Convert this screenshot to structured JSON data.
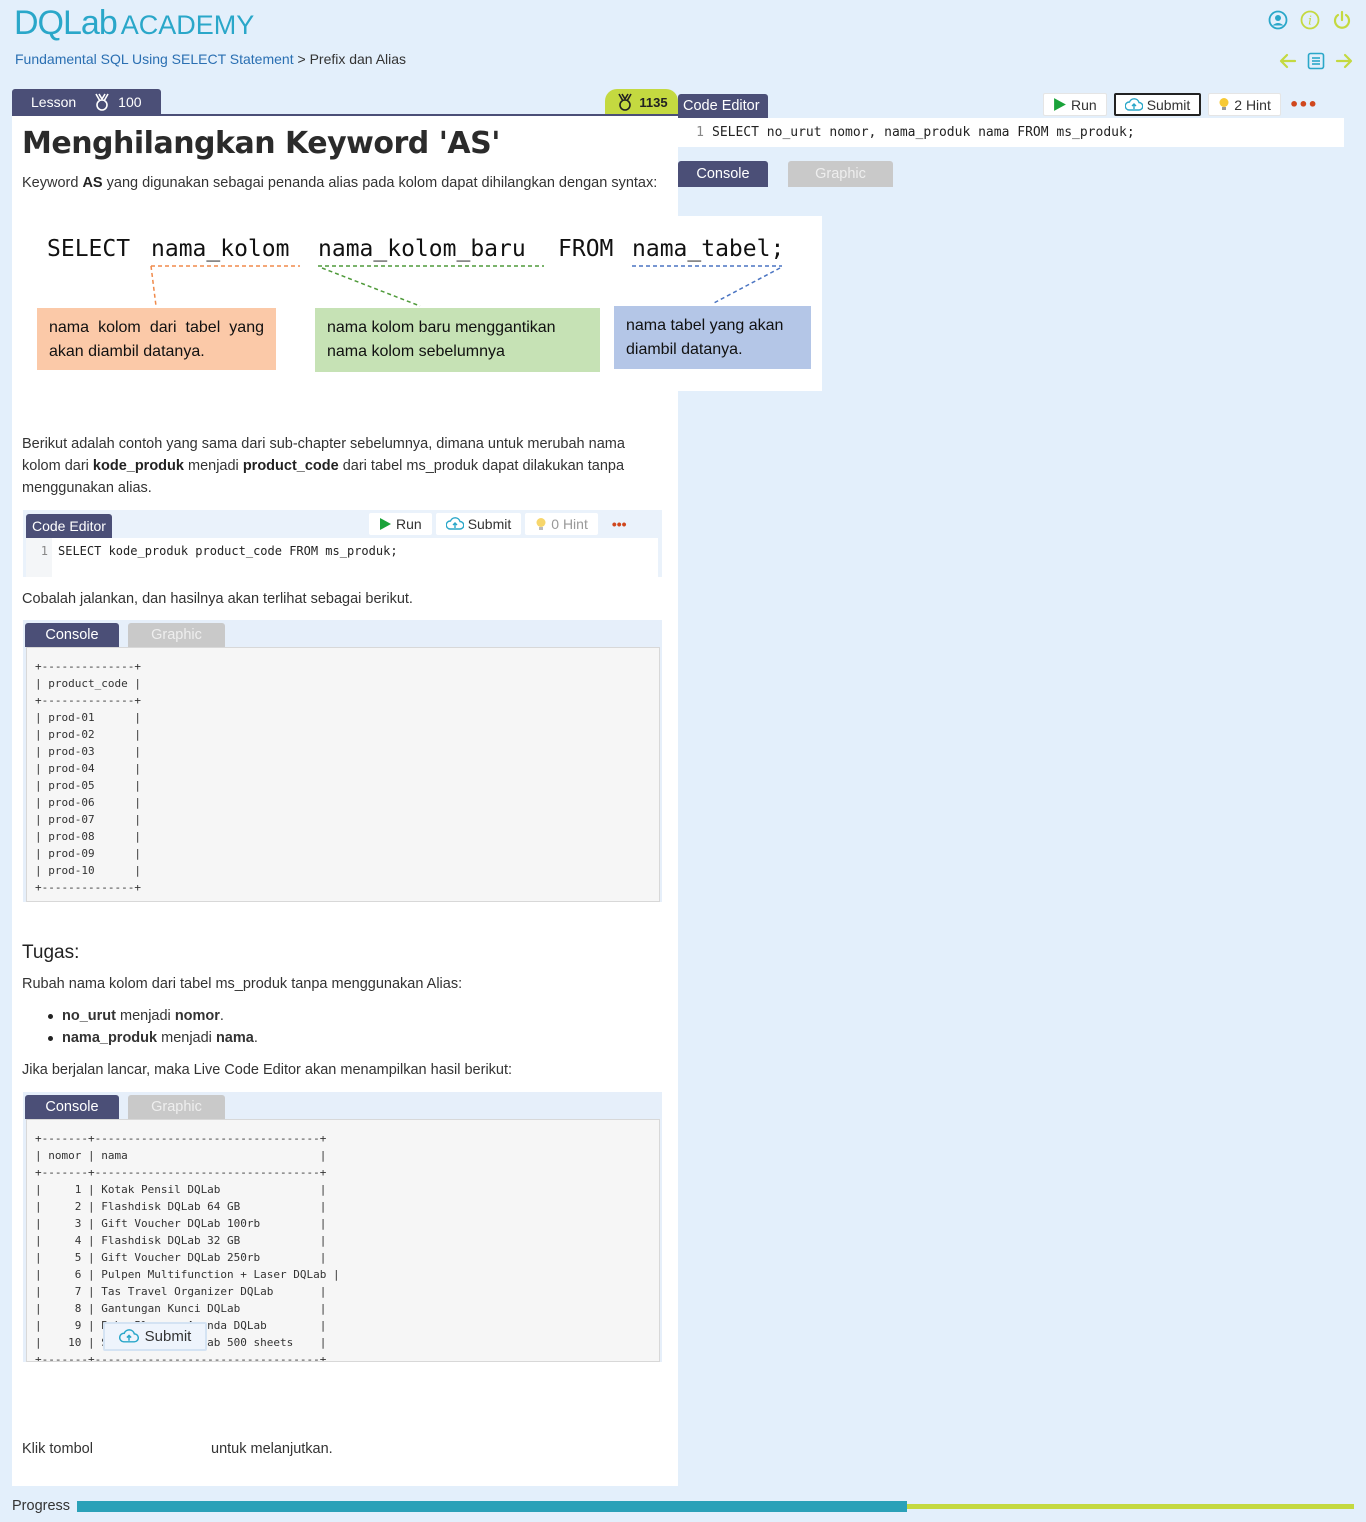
{
  "brand": {
    "logo_left": "DQLab",
    "logo_right": "ACADEMY"
  },
  "icons": {
    "profile": "user-icon",
    "info": "info-icon",
    "power": "power-icon",
    "back": "arrow-left-icon",
    "list": "list-icon",
    "forward": "arrow-right-icon",
    "medal": "medal-icon",
    "play": "play-icon",
    "upload": "upload-icon",
    "bulb": "bulb-icon",
    "more": "more-icon"
  },
  "colors": {
    "accent": "#4b4f77",
    "brand": "#2aa7c9",
    "lime": "#c4d940",
    "run_green": "#1aa33a"
  },
  "breadcrumb": {
    "course": "Fundamental SQL Using SELECT Statement",
    "separator": " > ",
    "current": "Prefix dan Alias"
  },
  "lesson": {
    "tab_label": "Lesson",
    "tab_points": "100",
    "score": "1135",
    "title": "Menghilangkan Keyword 'AS'",
    "intro_pre": "Keyword ",
    "intro_bold": "AS",
    "intro_post": " yang digunakan sebagai penanda alias pada kolom dapat dihilangkan dengan syntax:",
    "example_p1": "Berikut adalah contoh yang sama dari sub-chapter sebelumnya, dimana untuk merubah nama kolom dari ",
    "example_b1": "kode_produk",
    "example_p2": " menjadi ",
    "example_b2": "product_code",
    "example_p3": " dari tabel ms_produk dapat dilakukan tanpa menggunakan alias.",
    "try_text": "Cobalah jalankan, dan hasilnya akan terlihat sebagai berikut.",
    "task_title": "Tugas:",
    "task_intro": "Rubah nama kolom dari tabel ms_produk tanpa menggunakan Alias:",
    "task_items": [
      {
        "bold": "no_urut",
        "mid": " menjadi ",
        "bold2": "nomor",
        "end": "."
      },
      {
        "bold": "nama_produk",
        "mid": " menjadi ",
        "bold2": "nama",
        "end": "."
      }
    ],
    "result_text": "Jika berjalan lancar, maka Live Code Editor akan menampilkan hasil berikut:",
    "final_pre": "Klik tombol",
    "final_button": "Submit",
    "final_post": "untuk melanjutkan."
  },
  "diagram": {
    "syn_select": "SELECT",
    "syn_col": "nama_kolom",
    "syn_newcol": "nama_kolom_baru",
    "syn_from": "FROM",
    "syn_table": "nama_tabel;",
    "box1": "nama  kolom  dari  tabel yang akan diambil datanya.",
    "box2": "nama kolom baru menggantikan nama kolom sebelumnya",
    "box3": "nama tabel yang akan diambil datanya."
  },
  "embedded_editor": {
    "tab": "Code Editor",
    "run": "Run",
    "submit": "Submit",
    "hint": "0 Hint",
    "line_no": "1",
    "code": "SELECT kode_produk product_code FROM ms_produk;"
  },
  "console1": {
    "tab_active": "Console",
    "tab_inactive": "Graphic",
    "output": "+--------------+\n| product_code |\n+--------------+\n| prod-01      |\n| prod-02      |\n| prod-03      |\n| prod-04      |\n| prod-05      |\n| prod-06      |\n| prod-07      |\n| prod-08      |\n| prod-09      |\n| prod-10      |\n+--------------+"
  },
  "console2": {
    "tab_active": "Console",
    "tab_inactive": "Graphic",
    "output": "+-------+----------------------------------+\n| nomor | nama                             |\n+-------+----------------------------------+\n|     1 | Kotak Pensil DQLab               |\n|     2 | Flashdisk DQLab 64 GB            |\n|     3 | Gift Voucher DQLab 100rb         |\n|     4 | Flashdisk DQLab 32 GB            |\n|     5 | Gift Voucher DQLab 250rb         |\n|     6 | Pulpen Multifunction + Laser DQLab |\n|     7 | Tas Travel Organizer DQLab       |\n|     8 | Gantungan Kunci DQLab            |\n|     9 | Buku Planner Agenda DQLab        |\n|    10 | Sticky Notes DQLab 500 sheets    |\n+-------+----------------------------------+"
  },
  "editor": {
    "tab": "Code Editor",
    "run": "Run",
    "submit": "Submit",
    "hint": "2 Hint",
    "line_no": "1",
    "code": "SELECT no_urut nomor, nama_produk nama FROM ms_produk;",
    "console_tab": "Console",
    "graphic_tab": "Graphic"
  },
  "progress": {
    "label": "Progress",
    "value": 0.65
  }
}
